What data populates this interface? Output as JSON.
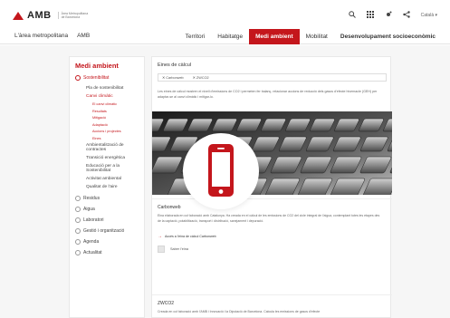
{
  "header": {
    "logo_text": "AMB",
    "logo_subtitle": "Àrea Metropolitana de Barcelona",
    "language": "Català",
    "icons": [
      "search-icon",
      "grid-icon",
      "settings-icon",
      "share-icon"
    ]
  },
  "nav": {
    "left": [
      "L'àrea metropolitana",
      "AMB"
    ],
    "right": [
      "Territori",
      "Habitatge",
      "Medi ambient",
      "Mobilitat",
      "Desenvolupament socioeconòmic"
    ],
    "active": "Medi ambient"
  },
  "sidebar": {
    "title": "Medi ambient",
    "items": [
      {
        "label": "Sostenibilitat",
        "active": true
      },
      {
        "label": "Residus",
        "active": false
      },
      {
        "label": "Aigua",
        "active": false
      },
      {
        "label": "Laboratori",
        "active": false
      },
      {
        "label": "Gestió i organització",
        "active": false
      },
      {
        "label": "Agenda",
        "active": false
      },
      {
        "label": "Actualitat",
        "active": false
      }
    ],
    "sostenibilitat_children": [
      "Pla de sostenibilitat",
      "Canvi climàtic",
      "Ambientalització de contractes",
      "Transició energètica",
      "Educació per a la Sostenibilitat",
      "Activitat ambiental",
      "Qualitat de l'aire"
    ],
    "canvi_climatic_children": [
      "El canvi climàtic",
      "Resultats",
      "Mitigació",
      "Adaptació",
      "Accions i projectes",
      "Eines"
    ]
  },
  "content": {
    "heading": "Eines de càlcul",
    "filters": [
      "Carbonweb",
      "ZWCO2"
    ],
    "intro": "Les eines de càlcul mostren el nivell d'emissions de CO2 i permeten fer balanç, relacionar accions de reducció dels gasos d'efecte hivernacle (GEH) per adaptar-se al canvi climàtic i mitigar-lo.",
    "card1": {
      "title": "Carbonweb",
      "text": "Eina elaborada en col·laboració amb Catalunya. Ha creada en el càlcul de les emissions de CO2 del cicle integral de l'aigua, contemplant totes les etapes des de la captació, potabilització, transport i distribució, sanejament i depuració.",
      "link": "Accés a l'eina de càlcul Carbonweb",
      "file": "Saber l'eina"
    },
    "card2": {
      "title": "ZWCO2",
      "text": "Creada en col·laboració amb l'AMB i Innovació i la Diputació de Barcelona. Calcula les emissions de gasos d'efecte"
    }
  },
  "overlay": {
    "icon": "mobile-phone-icon",
    "color": "#c4161c"
  },
  "colors": {
    "accent": "#c4161c"
  }
}
